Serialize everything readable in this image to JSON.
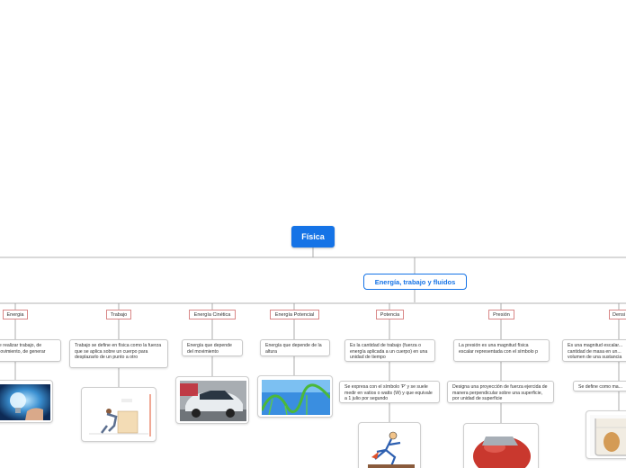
{
  "root": {
    "label": "Física"
  },
  "main": {
    "label": "Energía, trabajo y fluidos"
  },
  "topics": [
    {
      "label": "Energia",
      "desc": "de realizar trabajo, de movimiento, de generar",
      "image": "lightbulb-icon"
    },
    {
      "label": "Trabajo",
      "desc": "Trabajo se define en física como la fuerza que se aplica sobre un cuerpo para desplazarlo de un punto a otro",
      "image": "person-pushing-box-icon"
    },
    {
      "label": "Energía Cinética",
      "desc": "Energía que depende del movimiento",
      "image": "moving-car-icon"
    },
    {
      "label": "Energía Potencial",
      "desc": "Energía que depende de la altura",
      "image": "roller-coaster-icon"
    },
    {
      "label": "Potencia",
      "desc": "Es la cantidad de trabajo (fuerza o energía aplicada a un cuerpo) en una unidad de tiempo",
      "desc2": "Se expresa con el símbolo 'P' y se suele medir en vatios o watts (W) y que equivale a 1 julio por segundo",
      "image": "running-person-icon"
    },
    {
      "label": "Presión",
      "desc": "La presión es una magnitud física escalar representada con el símbolo p",
      "desc2": "Designa una proyección de fuerza ejercida de manera perpendicular sobre una superficie, por unidad de superficie",
      "image": "pressure-ball-icon"
    },
    {
      "label": "Densi",
      "desc": "Es una magnitud escalar... cantidad de masa en un... volumen de una sustancia",
      "desc2": "Se define como ma...",
      "image": "beaker-egg-icon"
    }
  ]
}
